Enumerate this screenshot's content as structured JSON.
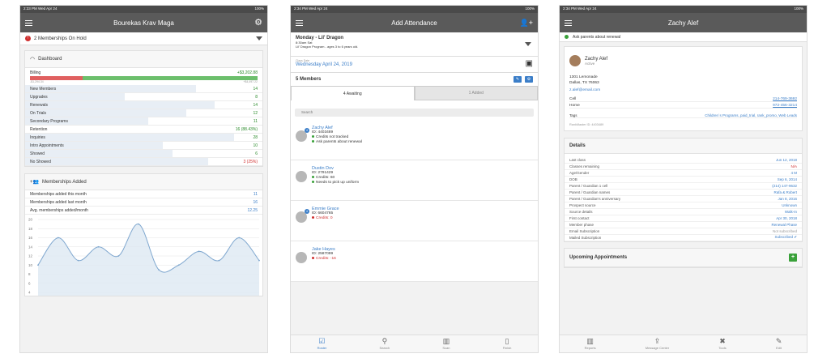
{
  "screen1": {
    "status_left": "2:33 PM  Wed Apr 24",
    "status_right": "100%",
    "title": "Bourekas Krav Maga",
    "alert": "2 Memberships On Hold",
    "dashboard": {
      "heading": "Dashboard",
      "billing_label": "Billing",
      "billing_value": "+$3,202.88",
      "billing_low": "-$1,294.34",
      "billing_high": "+$4,497.22",
      "billing_red_fraction": 0.23,
      "rows": [
        {
          "label": "New Members",
          "value": "14",
          "level": 0.72
        },
        {
          "label": "Upgrades",
          "value": "8",
          "level": 0.42
        },
        {
          "label": "Renewals",
          "value": "14",
          "level": 0.8
        },
        {
          "label": "On Trials",
          "value": "12",
          "level": 0.68
        },
        {
          "label": "Secondary Programs",
          "value": "11",
          "level": 0.52
        },
        {
          "label": "Retention",
          "value": "16 (88.43%)",
          "level": 0.0
        },
        {
          "label": "Inquiries",
          "value": "28",
          "level": 0.88
        },
        {
          "label": "Intro Appointments",
          "value": "10",
          "level": 0.58
        },
        {
          "label": "Showed",
          "value": "6",
          "level": 0.62
        },
        {
          "label": "No Showed",
          "value": "3 (25%)",
          "level": 0.77
        }
      ]
    },
    "memberships": {
      "heading": "Memberships Added",
      "rows": [
        {
          "label": "Memberships added this month",
          "value": "11"
        },
        {
          "label": "Memberships added last month",
          "value": "16"
        },
        {
          "label": "Avg. memberships added/month",
          "value": "12.25"
        }
      ]
    },
    "chart_data": {
      "type": "area",
      "title": "",
      "xlabel": "",
      "ylabel": "",
      "ylim": [
        4,
        20
      ],
      "yticks": [
        "20",
        "18",
        "16",
        "14",
        "12",
        "10",
        "8",
        "6",
        "4"
      ],
      "values": [
        10,
        16,
        11,
        14,
        12,
        19,
        9,
        10,
        13,
        11,
        16,
        11
      ]
    }
  },
  "screen2": {
    "status_left": "2:34 PM  Wed Apr 24",
    "status_right": "100%",
    "title": "Add Attendance",
    "class_name": "Monday - Lil' Dragon",
    "class_time": "8:30am Sat",
    "class_program": "Lil' Dragon Program - ages 3 to 6 years old.",
    "date_label": "Class Date",
    "date_value": "Wednesday April 24, 2019",
    "members_count": "5 Members",
    "tab_awaiting": "4 Awaiting",
    "tab_added": "1 Added",
    "search_placeholder": "Search",
    "members": [
      {
        "name": "Zachy Alef",
        "id": "ID: 4403489",
        "lines": [
          {
            "text": "Credits not tracked",
            "color": "#3aa13a"
          },
          {
            "text": "Ask parents about renewal",
            "color": "#3aa13a"
          }
        ],
        "badge": "4"
      },
      {
        "name": "Dustin Dov",
        "id": "ID: 2791429",
        "lines": [
          {
            "text": "Credits: 60",
            "color": "#3aa13a"
          },
          {
            "text": "Needs to pick up uniform",
            "color": "#3aa13a"
          }
        ],
        "badge": ""
      },
      {
        "name": "Emmie Grace",
        "id": "ID: 6604765",
        "lines": [
          {
            "text": "Credits: 0",
            "color": "#d03030"
          }
        ],
        "badge": "4"
      },
      {
        "name": "Jake Hayes",
        "id": "ID: 2587099",
        "lines": [
          {
            "text": "Credits: -16",
            "color": "#d03030"
          }
        ],
        "badge": ""
      }
    ],
    "tabs": [
      {
        "label": "Roster",
        "icon": "☑"
      },
      {
        "label": "Search",
        "icon": "⚲"
      },
      {
        "label": "Scan",
        "icon": "▥"
      },
      {
        "label": "Finish",
        "icon": "▯"
      }
    ]
  },
  "screen3": {
    "status_left": "2:34 PM  Wed Apr 24",
    "status_right": "100%",
    "title": "Zachy Alef",
    "alert": "Ask parents about renewal",
    "name": "Zachy Alef",
    "status": "Active",
    "address1": "1301 Lemonade",
    "address2": "Dallas, TX 76063",
    "email": "z.alef@email.com",
    "cell_label": "Cell",
    "cell_value": "214-769-3692",
    "home_label": "Home",
    "home_value": "972-456-3214",
    "tags_label": "Tags",
    "tags_value": "Children`s Programs, paid_trial, rank_promo, Web Leads",
    "rankmaster": "RankMaster ID: 4403489",
    "details_heading": "Details",
    "details": [
      {
        "k": "Last class",
        "v": "Jun 12, 2018",
        "c": "#3b7ec8"
      },
      {
        "k": "Classes remaining",
        "v": "N/A",
        "c": "#d03030"
      },
      {
        "k": "Age/Gender",
        "v": "4 M",
        "c": "#3b7ec8"
      },
      {
        "k": "DOB",
        "v": "Sep 6, 2014",
        "c": "#3b7ec8"
      },
      {
        "k": "Parent / Guardian 1 cell",
        "v": "(214) 147-9632",
        "c": "#3b7ec8"
      },
      {
        "k": "Parent / Guardian names",
        "v": "Rafa & Robert",
        "c": "#3b7ec8"
      },
      {
        "k": "Parent / Guardian's anniversary",
        "v": "Jan 8, 2016",
        "c": "#3b7ec8"
      },
      {
        "k": "Prospect source",
        "v": "Unknown",
        "c": "#3b7ec8"
      },
      {
        "k": "Source details",
        "v": "Walk-In",
        "c": "#3b7ec8"
      },
      {
        "k": "First contact",
        "v": "Apr 30, 2018",
        "c": "#3b7ec8"
      },
      {
        "k": "Member phase",
        "v": "Renewal Phase",
        "c": "#3b7ec8"
      },
      {
        "k": "Email Subscription",
        "v": "Not subscribed",
        "c": "#999999"
      },
      {
        "k": "Mailed Subscription",
        "v": "Subscribed ✔",
        "c": "#3b7ec8"
      }
    ],
    "appointments_heading": "Upcoming Appointments",
    "tabs": [
      {
        "label": "Reports",
        "icon": "▥"
      },
      {
        "label": "Message Center",
        "icon": "⇪"
      },
      {
        "label": "Tools",
        "icon": "✖"
      },
      {
        "label": "Edit",
        "icon": "✎"
      }
    ]
  }
}
